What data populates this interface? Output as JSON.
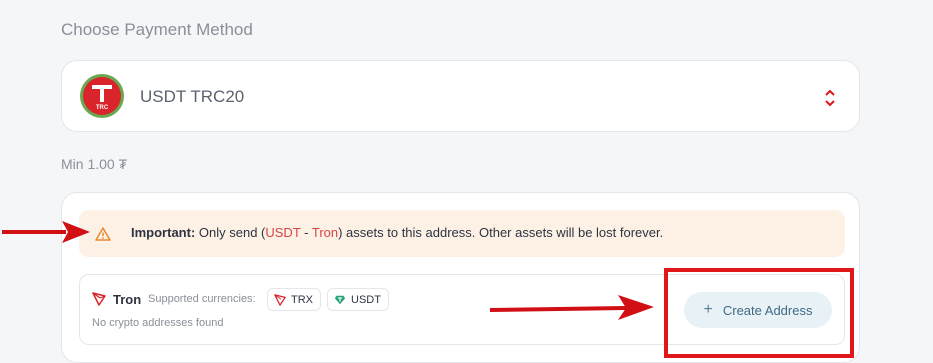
{
  "header": {
    "title": "Choose Payment Method"
  },
  "payment_method": {
    "selected": "USDT TRC20",
    "logo_letter": "T",
    "logo_text": "TRC"
  },
  "min_amount": "Min 1.00 ₮",
  "warning": {
    "bold": "Important:",
    "prefix": " Only send (",
    "asset": "USDT",
    "sep": " - ",
    "network": "Tron",
    "suffix": ") assets to this address. Other assets will be lost forever."
  },
  "network_card": {
    "network_name": "Tron",
    "supported_label": "Supported currencies:",
    "currencies": [
      "TRX",
      "USDT"
    ],
    "empty_message": "No crypto addresses found",
    "create_button": "Create Address"
  },
  "colors": {
    "accent_red": "#e0161b",
    "warning_bg": "#fdf1e6",
    "button_bg": "#e7f1f6",
    "tron_red": "#d8242a",
    "tether_green": "#26a17b"
  }
}
